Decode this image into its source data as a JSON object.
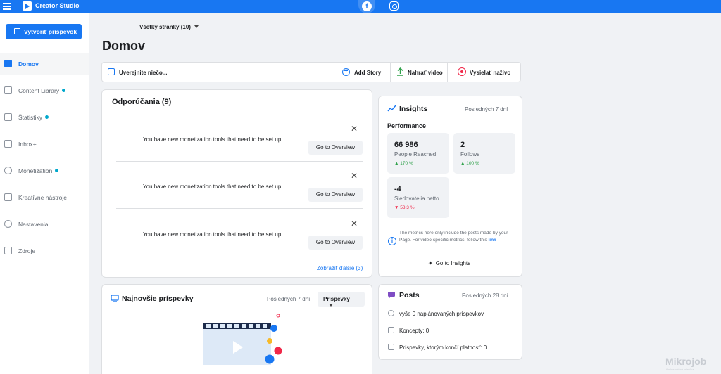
{
  "topbar": {
    "app_title": "Creator Studio",
    "platforms": [
      {
        "icon": "facebook-icon",
        "glyph": "f",
        "active": true
      },
      {
        "icon": "instagram-icon",
        "active": false
      }
    ]
  },
  "sidebar": {
    "create_button": "Vytvoriť príspevok",
    "items": [
      {
        "label": "Domov",
        "icon": "home-icon",
        "active": true,
        "dot": false
      },
      {
        "label": "Content Library",
        "icon": "library-icon",
        "active": false,
        "dot": true
      },
      {
        "label": "Štatistiky",
        "icon": "chart-icon",
        "active": false,
        "dot": true
      },
      {
        "label": "Inbox+",
        "icon": "inbox-icon",
        "active": false,
        "dot": false
      },
      {
        "label": "Monetization",
        "icon": "dollar-icon",
        "active": false,
        "dot": true
      },
      {
        "label": "Kreatívne nástroje",
        "icon": "tools-icon",
        "active": false,
        "dot": false
      },
      {
        "label": "Nastavenia",
        "icon": "settings-icon",
        "active": false,
        "dot": false
      },
      {
        "label": "Zdroje",
        "icon": "resources-icon",
        "active": false,
        "dot": false
      }
    ]
  },
  "header": {
    "page_selector": "Všetky stránky (10)",
    "title": "Domov"
  },
  "composer": {
    "placeholder": "Uverejnite niečo...",
    "add_story": "Add Story",
    "upload_video": "Nahrať video",
    "go_live": "Vysielať naživo"
  },
  "recommendations": {
    "title": "Odporúčania (9)",
    "items": [
      {
        "message": "You have new monetization tools that need to be set up.",
        "button": "Go to Overview",
        "close": "✕"
      },
      {
        "message": "You have new monetization tools that need to be set up.",
        "button": "Go to Overview",
        "close": "✕"
      },
      {
        "message": "You have new monetization tools that need to be set up.",
        "button": "Go to Overview",
        "close": "✕"
      }
    ],
    "show_more": "Zobraziť ďalšie (3)"
  },
  "insights": {
    "title": "Insights",
    "period": "Posledných 7 dní",
    "section": "Performance",
    "metrics": [
      {
        "value": "66 986",
        "label": "People Reached",
        "change": "170 %",
        "direction": "up"
      },
      {
        "value": "2",
        "label": "Follows",
        "change": "100 %",
        "direction": "up"
      },
      {
        "value": "-4",
        "label": "Sledovatelia netto",
        "change": "53.3 %",
        "direction": "down"
      }
    ],
    "note": "The metrics here only include the posts made by your Page. For video-specific metrics, follow this",
    "note_link": "link",
    "goto": "Go to Insights",
    "colors": {
      "up": "#31a24c",
      "down": "#f02849"
    }
  },
  "latest_posts": {
    "title": "Najnovšie príspevky",
    "period": "Posledných 7 dní",
    "filter": "Príspevky"
  },
  "posts": {
    "title": "Posts",
    "period": "Posledných 28 dní",
    "lines": [
      {
        "icon": "clock-icon",
        "text": "vyše 0 naplánovaných príspevkov"
      },
      {
        "icon": "draft-icon",
        "text": "Koncepty: 0"
      },
      {
        "icon": "expiring-icon",
        "text": "Príspevky, ktorým končí platnosť: 0"
      }
    ]
  },
  "watermark": {
    "brand": "Mikrojob",
    "tagline": "Online cvičná príručka"
  },
  "colors": {
    "brand": "#1877f2",
    "background": "#f0f2f5"
  }
}
